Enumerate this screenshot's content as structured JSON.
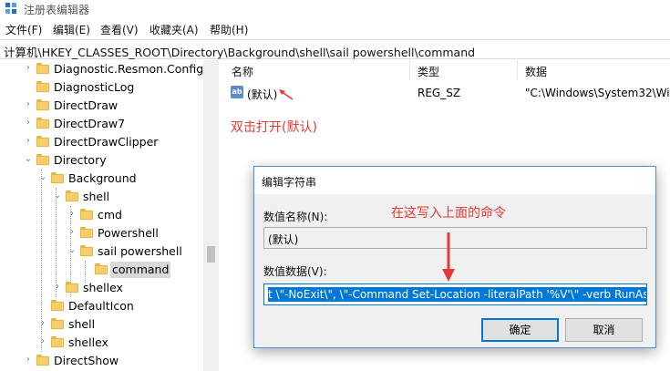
{
  "window": {
    "title": "注册表编辑器"
  },
  "menu": [
    "文件(F)",
    "编辑(E)",
    "查看(V)",
    "收藏夹(A)",
    "帮助(H)"
  ],
  "address": "计算机\\HKEY_CLASSES_ROOT\\Directory\\Background\\shell\\sail powershell\\command",
  "tree": [
    {
      "label": "Diagnostic.Resmon.Config",
      "expander": "right"
    },
    {
      "label": "DiagnosticLog",
      "expander": ""
    },
    {
      "label": "DirectDraw",
      "expander": "right"
    },
    {
      "label": "DirectDraw7",
      "expander": "right"
    },
    {
      "label": "DirectDrawClipper",
      "expander": "right"
    },
    {
      "label": "Directory",
      "expander": "down"
    },
    {
      "label": "Background",
      "expander": "down"
    },
    {
      "label": "shell",
      "expander": "down"
    },
    {
      "label": "cmd",
      "expander": "right"
    },
    {
      "label": "Powershell",
      "expander": "right"
    },
    {
      "label": "sail powershell",
      "expander": "down"
    },
    {
      "label": "command",
      "expander": "",
      "selected": true
    },
    {
      "label": "shellex",
      "expander": "right"
    },
    {
      "label": "DefaultIcon",
      "expander": ""
    },
    {
      "label": "shell",
      "expander": "right"
    },
    {
      "label": "shellex",
      "expander": "right"
    },
    {
      "label": "DirectShow",
      "expander": "right"
    }
  ],
  "list": {
    "headers": {
      "name": "名称",
      "type": "类型",
      "data": "数据"
    },
    "rows": [
      {
        "icon": "ab",
        "name": "(默认)",
        "type": "REG_SZ",
        "data": "\"C:\\Windows\\System32\\Wir"
      }
    ]
  },
  "annotations": {
    "double_click": "双击打开(默认)",
    "write_command": "在这写入上面的命令"
  },
  "dialog": {
    "title": "编辑字符串",
    "name_label": "数值名称(N):",
    "name_value": "(默认)",
    "data_label": "数值数据(V):",
    "data_value": "t \\\"-NoExit\\\", \\\"-Command Set-Location -literalPath '%V'\\\" -verb RunAs",
    "ok": "确定",
    "cancel": "取消"
  },
  "colors": {
    "annotation": "#e53935",
    "accent": "#0078d7",
    "folder": "#f7cf6a"
  }
}
